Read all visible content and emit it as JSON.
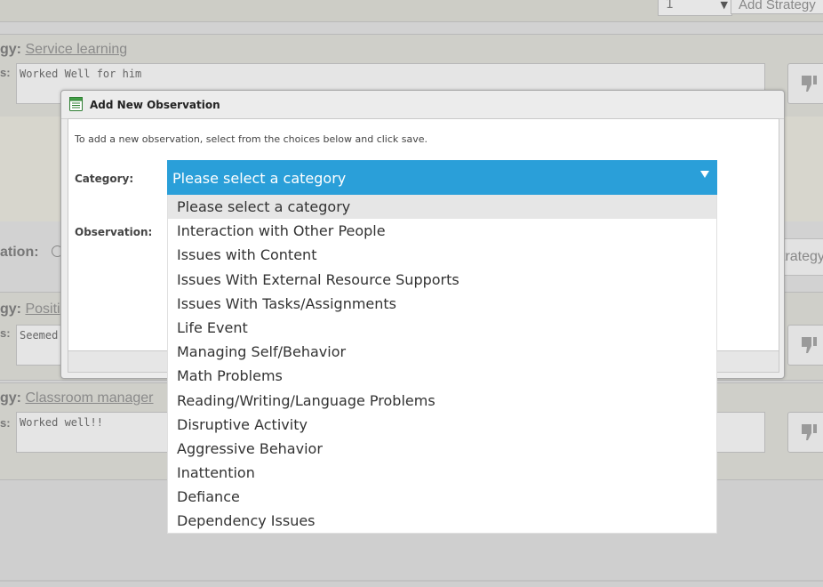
{
  "background": {
    "top_select_value": "1",
    "add_strategy_label": "Add Strategy",
    "strategy1": {
      "label_suffix": "gy:",
      "name": "Service learning",
      "notes_label_suffix": "s:",
      "notes": "Worked Well for him"
    },
    "observation_label_suffix": "ation:",
    "strategy_button_partial": "trategy",
    "strategy2": {
      "label_suffix": "gy:",
      "name": "Positi",
      "notes_label_suffix": "s:",
      "notes": "Seemed"
    },
    "strategy3": {
      "label_suffix": "gy:",
      "name": "Classroom manager",
      "notes_label_suffix": "s:",
      "notes": "Worked well!!"
    }
  },
  "dialog": {
    "title": "Add New Observation",
    "instructions": "To add a new observation, select from the choices below and click save.",
    "category_label": "Category:",
    "observation_label": "Observation:",
    "select": {
      "selected": "Please select a category",
      "options": [
        "Please select a category",
        "Interaction with Other People",
        "Issues with Content",
        "Issues With External Resource Supports",
        "Issues With Tasks/Assignments",
        "Life Event",
        "Managing Self/Behavior",
        "Math Problems",
        "Reading/Writing/Language Problems",
        "Disruptive Activity",
        "Aggressive Behavior",
        "Inattention",
        "Defiance",
        "Dependency Issues"
      ]
    }
  },
  "colors": {
    "select_bg": "#2a9fd9",
    "highlight_option": "#e6e6e6"
  }
}
